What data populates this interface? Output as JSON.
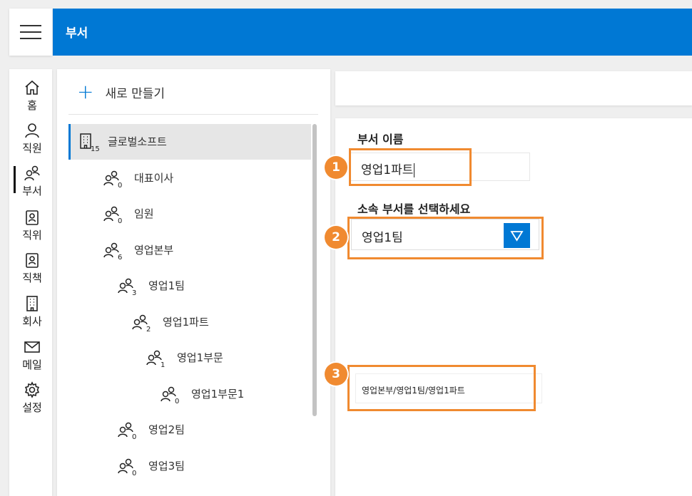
{
  "header": {
    "title": "부서",
    "menu_icon": "hamburger-icon",
    "accent": "#0078d4"
  },
  "nav": {
    "items": [
      {
        "label": "홈",
        "icon": "home-icon"
      },
      {
        "label": "직원",
        "icon": "person-icon"
      },
      {
        "label": "부서",
        "icon": "people-icon",
        "active": true
      },
      {
        "label": "직위",
        "icon": "badge-icon"
      },
      {
        "label": "직책",
        "icon": "badge-icon"
      },
      {
        "label": "회사",
        "icon": "building-icon"
      },
      {
        "label": "메일",
        "icon": "mail-icon"
      },
      {
        "label": "설정",
        "icon": "gear-icon"
      }
    ]
  },
  "tree": {
    "new_label": "새로 만들기",
    "rows": [
      {
        "label": "글로벌소프트",
        "count": "15",
        "icon": "building-icon",
        "depth": 0,
        "selected": true
      },
      {
        "label": "대표이사",
        "count": "0",
        "icon": "people-icon",
        "depth": 1
      },
      {
        "label": "임원",
        "count": "0",
        "icon": "people-icon",
        "depth": 1
      },
      {
        "label": "영업본부",
        "count": "6",
        "icon": "people-icon",
        "depth": 1
      },
      {
        "label": "영업1팀",
        "count": "3",
        "icon": "people-icon",
        "depth": 2
      },
      {
        "label": "영업1파트",
        "count": "2",
        "icon": "people-icon",
        "depth": 3
      },
      {
        "label": "영업1부문",
        "count": "1",
        "icon": "people-icon",
        "depth": 4
      },
      {
        "label": "영업1부문1",
        "count": "0",
        "icon": "people-icon",
        "depth": 5
      },
      {
        "label": "영업2팀",
        "count": "0",
        "icon": "people-icon",
        "depth": 2
      },
      {
        "label": "영업3팀",
        "count": "0",
        "icon": "people-icon",
        "depth": 2
      }
    ]
  },
  "form": {
    "name_label": "부서 이름",
    "name_value": "영업1파트",
    "parent_label": "소속 부서를 선택하세요",
    "parent_value": "영업1팀",
    "path": "영업본부/영업1팀/영업1파트"
  },
  "callouts": [
    "1",
    "2",
    "3"
  ],
  "colors": {
    "callout": "#f08a30",
    "accent": "#0078d4"
  }
}
